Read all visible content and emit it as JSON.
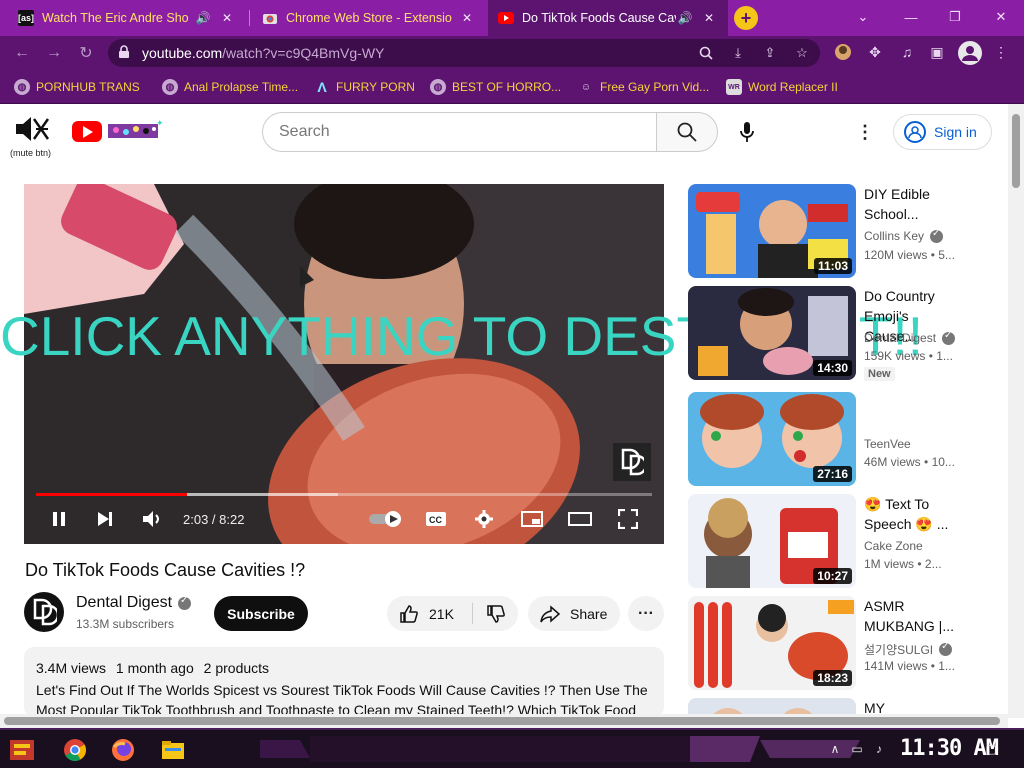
{
  "browser": {
    "tabs": [
      {
        "favicon": "[as]",
        "title": "Watch The Eric Andre Sho",
        "audio": true
      },
      {
        "favicon": "chrome-webstore-icon",
        "title": "Chrome Web Store - Extensio",
        "audio": false
      },
      {
        "favicon": "youtube-icon",
        "title": "Do TikTok Foods Cause Cav",
        "audio": true,
        "active": true
      }
    ],
    "url_host": "youtube.com",
    "url_path": "/watch?v=c9Q4BmVg-WY",
    "bookmarks": [
      "PORNHUB TRANS",
      "Anal Prolapse Time...",
      "FURRY PORN",
      "BEST OF HORRO...",
      "Free Gay Porn Vid...",
      "Word Replacer II"
    ],
    "accent": "#8a1fa6",
    "toolbar_color": "#5c1470",
    "bookmark_text_color": "#f2d43a"
  },
  "youtube": {
    "mute_label": "(mute btn)",
    "search_placeholder": "Search",
    "signin_label": "Sign in",
    "overlay_text": "CLICK ANYTHING TO DESTROY IT!!",
    "overlay_color": "#3ad5c2",
    "player": {
      "time": "2:03 / 8:22",
      "progress": 0.245,
      "buffered": 0.49,
      "watermark": "D"
    },
    "video": {
      "title": "Do TikTok Foods Cause Cavities !?",
      "channel": "Dental Digest",
      "subscribers": "13.3M subscribers",
      "subscribe_label": "Subscribe",
      "likes": "21K",
      "share_label": "Share",
      "views": "3.4M views",
      "age": "1 month ago",
      "products": "2 products",
      "description": "Let's Find Out If The Worlds Spicest vs Sourest TikTok Foods Will Cause Cavities !? Then Use The Most Popular TikTok Toothbrush and Toothpaste to Clean my Stained Teeth!? Which TikTok Food"
    },
    "recommendations": [
      {
        "title": "DIY Edible School...",
        "channel": "Collins Key",
        "verified": true,
        "views": "120M views",
        "age": "5...",
        "duration": "11:03"
      },
      {
        "title": "Do Country Emoji's Cause...",
        "channel": "Dental Digest",
        "verified": true,
        "views": "159K views",
        "age": "1...",
        "duration": "14:30",
        "badge": "New"
      },
      {
        "title": "",
        "channel": "TeenVee",
        "verified": false,
        "views": "46M views",
        "age": "10...",
        "duration": "27:16"
      },
      {
        "title": "😍 Text To Speech 😍 ...",
        "channel": "Cake Zone",
        "verified": false,
        "views": "1M views",
        "age": "2...",
        "duration": "10:27"
      },
      {
        "title": "ASMR MUKBANG |...",
        "channel": "설기양SULGI",
        "verified": true,
        "views": "141M views",
        "age": "1...",
        "duration": "18:23"
      },
      {
        "title": "MY",
        "channel": "",
        "verified": false,
        "views": "",
        "age": "",
        "duration": ""
      }
    ]
  },
  "taskbar": {
    "clock": "11:30 AM"
  }
}
